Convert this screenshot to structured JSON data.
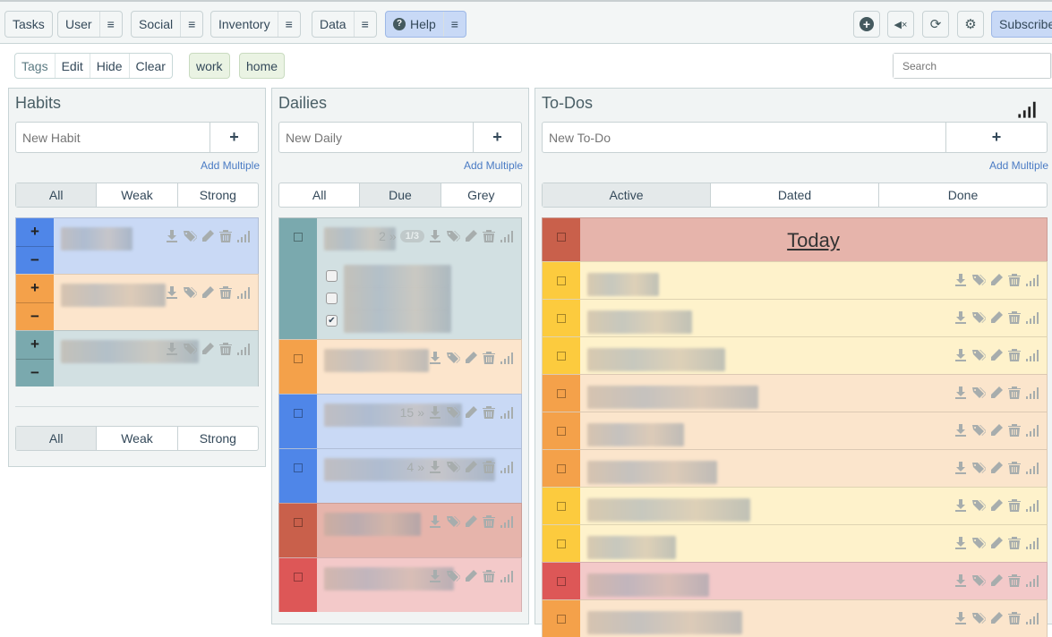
{
  "nav": {
    "tasks": "Tasks",
    "user": "User",
    "social": "Social",
    "inventory": "Inventory",
    "data": "Data",
    "help": "Help",
    "subscribe": "Subscribe",
    "menu_icon": "≡"
  },
  "tags": {
    "label": "Tags",
    "edit": "Edit",
    "hide": "Hide",
    "clear": "Clear",
    "items": [
      "work",
      "home"
    ]
  },
  "search": {
    "placeholder": "Search"
  },
  "habits": {
    "title": "Habits",
    "placeholder": "New Habit",
    "add": "+",
    "add_multiple": "Add Multiple",
    "filters": [
      "All",
      "Weak",
      "Strong"
    ],
    "items": [
      {
        "stripe": "#4f86e8",
        "bg": "#c9d9f5"
      },
      {
        "stripe": "#f4a14a",
        "bg": "#fce5cc"
      },
      {
        "stripe": "#7aa9ae",
        "bg": "#d2e0e2"
      }
    ]
  },
  "dailies": {
    "title": "Dailies",
    "placeholder": "New Daily",
    "add": "+",
    "add_multiple": "Add Multiple",
    "filters": [
      "All",
      "Due",
      "Grey"
    ],
    "items": [
      {
        "stripe": "#7aa9ae",
        "bg": "#d2e0e2",
        "streak": "2",
        "checklist": "1/3",
        "checklist_items": [
          false,
          false,
          true
        ],
        "h": 136
      },
      {
        "stripe": "#f4a14a",
        "bg": "#fce5cc",
        "h": 61
      },
      {
        "stripe": "#4f86e8",
        "bg": "#c9d9f5",
        "streak": "15",
        "h": 61
      },
      {
        "stripe": "#4f86e8",
        "bg": "#c9d9f5",
        "streak": "4",
        "h": 61
      },
      {
        "stripe": "#c9604b",
        "bg": "#e6b4ab",
        "h": 61
      },
      {
        "stripe": "#dd5757",
        "bg": "#f3c9c9",
        "h": 61
      }
    ]
  },
  "todos": {
    "title": "To-Dos",
    "placeholder": "New To-Do",
    "add": "+",
    "add_multiple": "Add Multiple",
    "filters": [
      "Active",
      "Dated",
      "Done"
    ],
    "today": "Today",
    "items": [
      {
        "stripe": "#fccb3e",
        "bg": "#fef2cb"
      },
      {
        "stripe": "#fccb3e",
        "bg": "#fef2cb"
      },
      {
        "stripe": "#fccb3e",
        "bg": "#fef2cb"
      },
      {
        "stripe": "#f4a14a",
        "bg": "#fbe5cc"
      },
      {
        "stripe": "#f4a14a",
        "bg": "#fbe5cc"
      },
      {
        "stripe": "#f4a14a",
        "bg": "#fbe5cc"
      },
      {
        "stripe": "#fccb3e",
        "bg": "#fef2cb"
      },
      {
        "stripe": "#fccb3e",
        "bg": "#fef2cb"
      },
      {
        "stripe": "#dd5757",
        "bg": "#f3c9c9"
      },
      {
        "stripe": "#f4a14a",
        "bg": "#fbe5cc"
      }
    ]
  }
}
